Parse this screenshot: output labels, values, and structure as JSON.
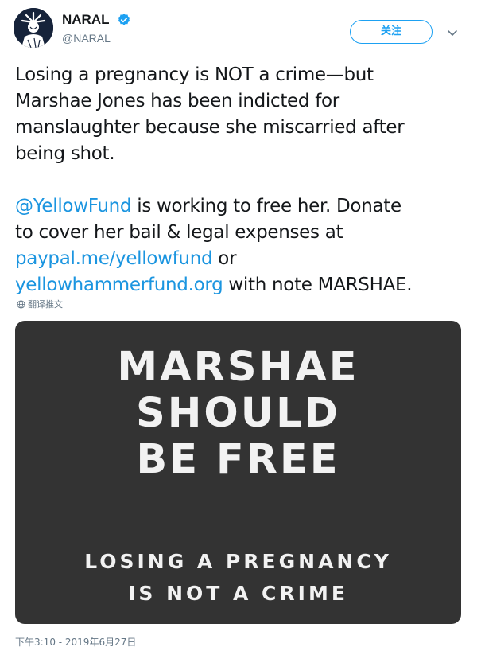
{
  "author": {
    "display_name": "NARAL",
    "handle": "@NARAL",
    "verified": true
  },
  "actions": {
    "follow_label": "关注"
  },
  "tweet": {
    "line1": "Losing a pregnancy is NOT a crime—but",
    "line2": "Marshae Jones has been indicted for",
    "line3": "manslaughter because she miscarried after",
    "line4": "being shot.",
    "mention": "@YellowFund",
    "line5_rest": " is working to free her. Donate",
    "line6": "to cover her bail & legal expenses at",
    "link1": "paypal.me/yellowfund",
    "line7_rest": " or",
    "link2": "yellowhammerfund.org",
    "line8_rest": " with note MARSHAE."
  },
  "translate_label": "翻译推文",
  "media": {
    "headline": [
      "MARSHAE",
      "SHOULD",
      "BE FREE"
    ],
    "subline": [
      "LOSING A PREGNANCY",
      "IS NOT A CRIME"
    ]
  },
  "timestamp": "下午3:10 - 2019年6月27日",
  "colors": {
    "link": "#1b95e0",
    "follow_border": "#1da1f2",
    "verified": "#1da1f2",
    "media_bg": "#333333",
    "muted_text": "#657786"
  },
  "icons": {
    "avatar": "statue-of-liberty-logo",
    "verified": "verified-badge-icon",
    "caret": "chevron-down-icon",
    "translate": "globe-icon"
  }
}
